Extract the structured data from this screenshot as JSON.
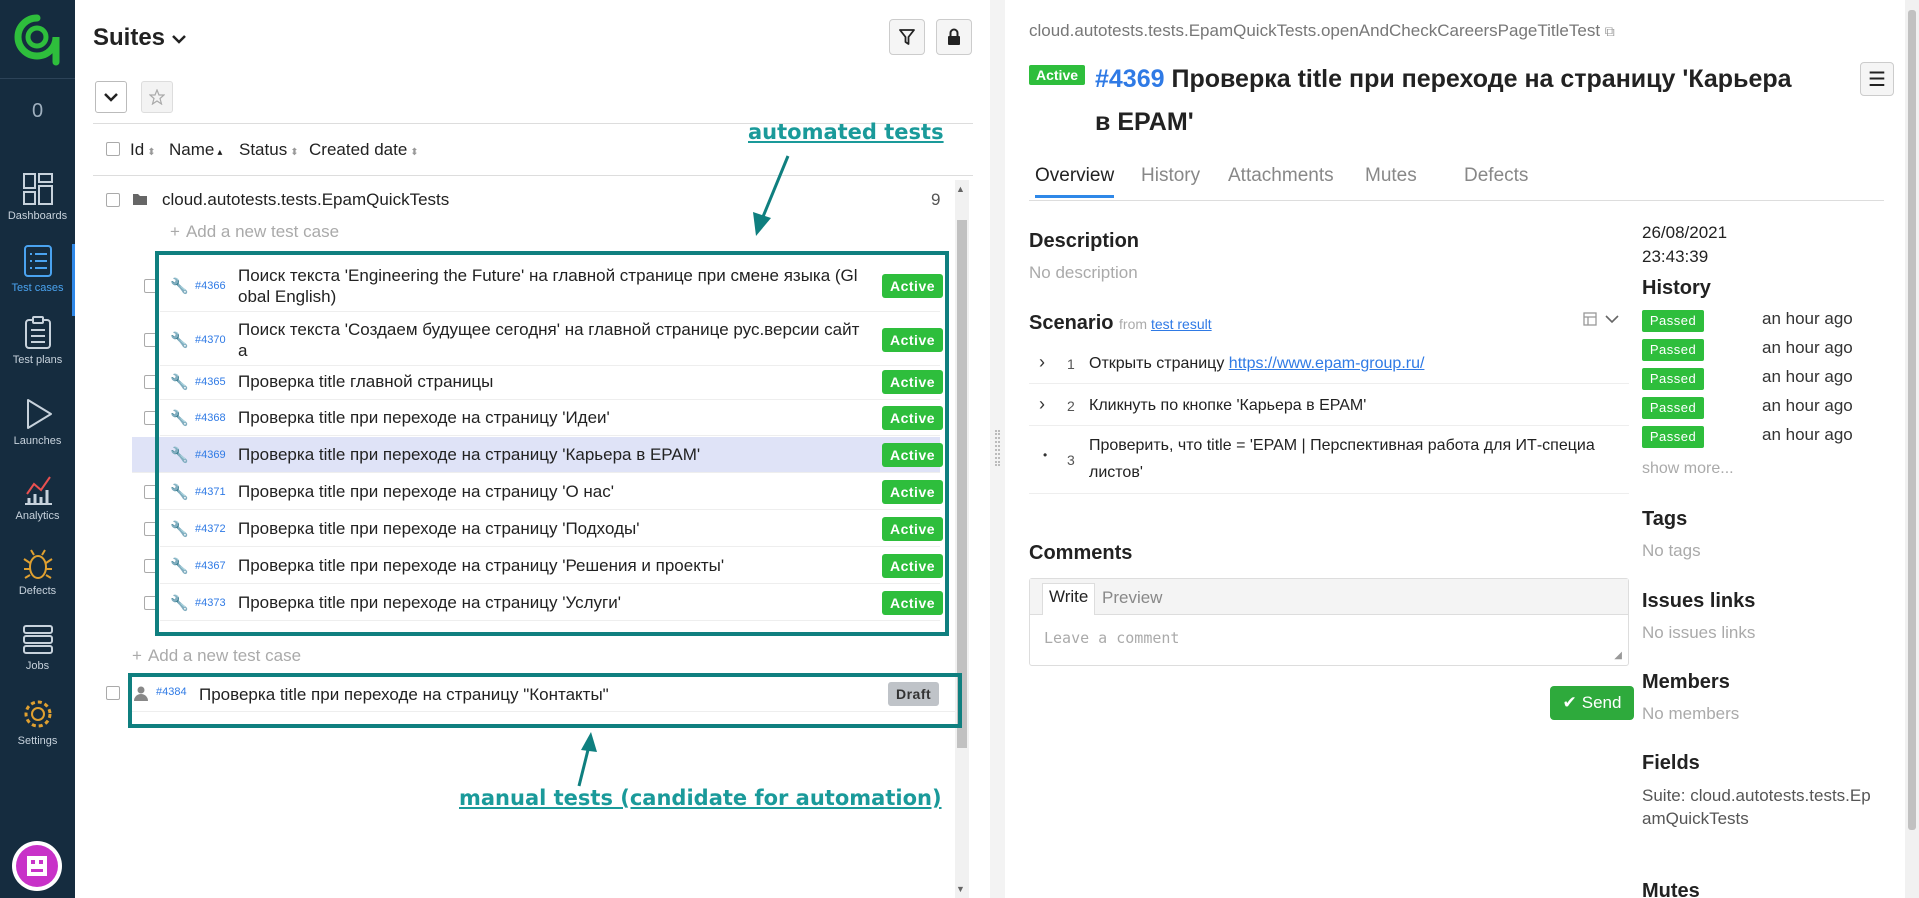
{
  "sidebar": {
    "counter": "0",
    "items": [
      {
        "label": "Dashboards",
        "icon": "dashboards-icon"
      },
      {
        "label": "Test cases",
        "icon": "test-cases-icon",
        "active": true
      },
      {
        "label": "Test plans",
        "icon": "test-plans-icon"
      },
      {
        "label": "Launches",
        "icon": "launches-icon"
      },
      {
        "label": "Analytics",
        "icon": "analytics-icon"
      },
      {
        "label": "Defects",
        "icon": "defects-icon"
      },
      {
        "label": "Jobs",
        "icon": "jobs-icon"
      },
      {
        "label": "Settings",
        "icon": "settings-icon"
      }
    ]
  },
  "left": {
    "title": "Suites",
    "columns": {
      "id": "Id",
      "name": "Name",
      "status": "Status",
      "created": "Created date"
    },
    "suite": {
      "name": "cloud.autotests.tests.EpamQuickTests",
      "count": "9"
    },
    "add_case": "Add a new test case",
    "rows": [
      {
        "id": "#4366",
        "name": "Поиск текста 'Engineering the Future' на главной странице при смене языка (Gl",
        "name2": "obal English)",
        "status": "Active"
      },
      {
        "id": "#4370",
        "name": "Поиск текста 'Создаем будущее сегодня' на главной странице рус.версии сайт",
        "name2": "а",
        "status": "Active"
      },
      {
        "id": "#4365",
        "name": "Проверка title главной страницы",
        "status": "Active"
      },
      {
        "id": "#4368",
        "name": "Проверка title при переходе на страницу 'Идеи'",
        "status": "Active"
      },
      {
        "id": "#4369",
        "name": "Проверка title при переходе на страницу 'Карьера в EPAM'",
        "status": "Active"
      },
      {
        "id": "#4371",
        "name": "Проверка title при переходе на страницу 'О нас'",
        "status": "Active"
      },
      {
        "id": "#4372",
        "name": "Проверка title при переходе на страницу 'Подходы'",
        "status": "Active"
      },
      {
        "id": "#4367",
        "name": "Проверка title при переходе на страницу 'Решения и проекты'",
        "status": "Active"
      },
      {
        "id": "#4373",
        "name": "Проверка title при переходе на страницу 'Услуги'",
        "status": "Active"
      }
    ],
    "manual_row": {
      "id": "#4384",
      "name": "Проверка title при переходе на страницу \"Контакты\"",
      "status": "Draft"
    },
    "annotation_auto": "automated tests",
    "annotation_manual": "manual tests (candidate for automation)"
  },
  "right": {
    "full_name": "cloud.autotests.tests.EpamQuickTests.openAndCheckCareersPageTitleTest",
    "status": "Active",
    "number": "#4369",
    "title": "Проверка title при переходе на страницу 'Карьера в EPAM'",
    "tabs": [
      "Overview",
      "History",
      "Attachments",
      "Mutes",
      "Defects"
    ],
    "description_h": "Description",
    "description": "No description",
    "scenario_h": "Scenario",
    "scenario_from": "from",
    "scenario_link": "test result",
    "steps": [
      {
        "n": "1",
        "text": "Открыть страницу ",
        "link": "https://www.epam-group.ru/"
      },
      {
        "n": "2",
        "text": "Кликнуть по кнопке 'Карьера в EPAM'"
      },
      {
        "n": "3",
        "text": "Проверить, что title = 'EPAM | Перспективная работа для ИТ-специа листов'"
      }
    ],
    "comments_h": "Comments",
    "write_tab": "Write",
    "preview_tab": "Preview",
    "comment_placeholder": "Leave a comment",
    "send": "Send",
    "date": "26/08/2021",
    "time": "23:43:39",
    "history_h": "History",
    "history": [
      {
        "status": "Passed",
        "ago": "an hour ago"
      },
      {
        "status": "Passed",
        "ago": "an hour ago"
      },
      {
        "status": "Passed",
        "ago": "an hour ago"
      },
      {
        "status": "Passed",
        "ago": "an hour ago"
      },
      {
        "status": "Passed",
        "ago": "an hour ago"
      }
    ],
    "show_more": "show more...",
    "tags_h": "Tags",
    "tags": "No tags",
    "issues_h": "Issues links",
    "issues": "No issues links",
    "members_h": "Members",
    "members": "No members",
    "fields_h": "Fields",
    "fields_suite": "Suite: cloud.autotests.tests.EpamQuickTests",
    "mutes_h": "Mutes"
  },
  "colors": {
    "accent": "#2f88e8",
    "active": "#2ebe3c",
    "annotation": "#0f7f7f",
    "sidebar": "#152c3f"
  }
}
